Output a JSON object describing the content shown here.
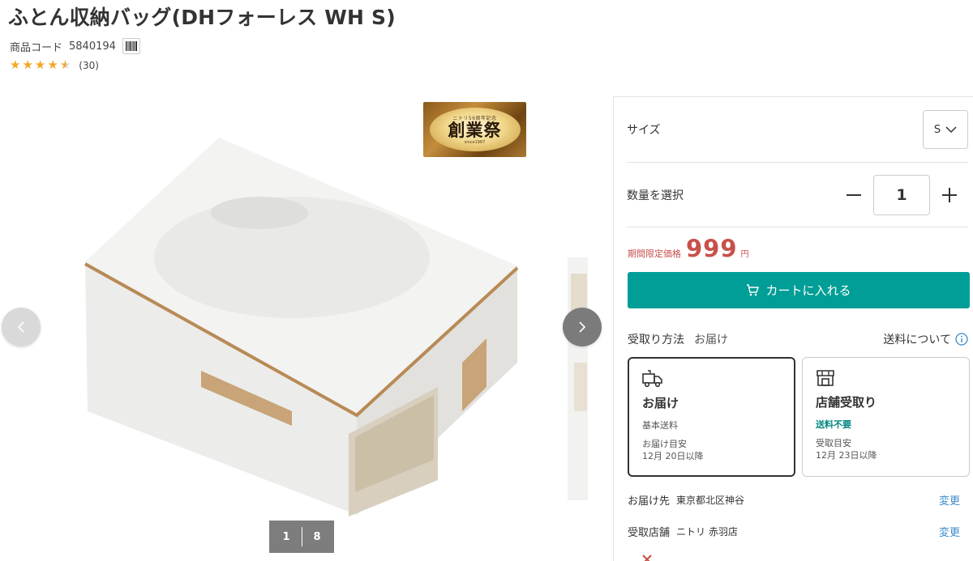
{
  "product": {
    "title": "ふとん収納バッグ(DHフォーレス WH S)",
    "code_label": "商品コード",
    "code_value": "5840194",
    "rating_stars": 4.5,
    "rating_count": "(30)"
  },
  "gallery": {
    "badge_main": "創業祭",
    "badge_top": "ニトリ56周年記念",
    "badge_bottom": "since1967",
    "current_page": "1",
    "total_pages": "8"
  },
  "options": {
    "size_label": "サイズ",
    "size_value": "S",
    "quantity_label": "数量を選択",
    "quantity_value": "1"
  },
  "price": {
    "label": "期間限定価格",
    "value": "999",
    "currency": "円"
  },
  "cart": {
    "button_label": "カートに入れる"
  },
  "delivery": {
    "method_label": "受取り方法",
    "method_value": "お届け",
    "shipping_info_link": "送料について",
    "cards": [
      {
        "title": "お届け",
        "fee": "基本送料",
        "eta_label": "お届け目安",
        "eta_value": "12月 20日以降"
      },
      {
        "title": "店舗受取り",
        "fee": "送料不要",
        "eta_label": "受取目安",
        "eta_value": "12月 23日以降"
      }
    ],
    "destination_label": "お届け先",
    "destination_value": "東京都北区神谷",
    "store_label": "受取店舗",
    "store_value": "ニトリ 赤羽店",
    "change_label": "変更"
  },
  "colors": {
    "accent": "#009e96",
    "price": "#c7504b",
    "link": "#3d8bc9",
    "star": "#f5a623"
  }
}
